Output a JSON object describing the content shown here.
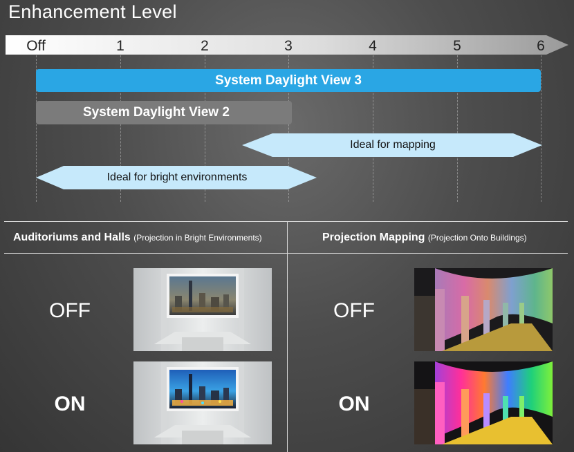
{
  "title": "Enhancement Level",
  "scale": {
    "ticks": [
      "Off",
      "1",
      "2",
      "3",
      "4",
      "5",
      "6"
    ]
  },
  "bars": {
    "sdv3": "System Daylight View 3",
    "sdv2": "System Daylight View 2",
    "mapping": "Ideal for mapping",
    "bright": "Ideal for bright environments"
  },
  "panels": {
    "left": {
      "heading": "Auditoriums and Halls",
      "subheading": "(Projection in Bright Environments)"
    },
    "right": {
      "heading": "Projection Mapping",
      "subheading": "(Projection Onto Buildings)"
    },
    "off_label": "OFF",
    "on_label": "ON"
  },
  "colors": {
    "accent_blue": "#2aa6e4",
    "gray_bar": "#7b7b7b",
    "light_blue": "#c6e9fb"
  }
}
